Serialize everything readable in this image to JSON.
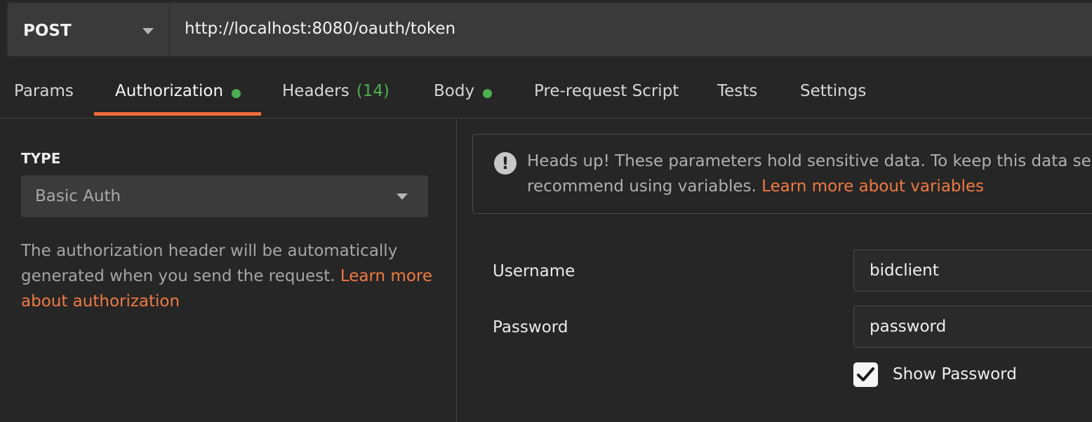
{
  "request": {
    "method": "POST",
    "url": "http://localhost:8080/oauth/token"
  },
  "tabs": [
    {
      "label": "Params"
    },
    {
      "label": "Authorization",
      "active": true,
      "indicator": "green-dot"
    },
    {
      "label": "Headers",
      "count": "(14)"
    },
    {
      "label": "Body",
      "indicator": "green-dot"
    },
    {
      "label": "Pre-request Script"
    },
    {
      "label": "Tests"
    },
    {
      "label": "Settings"
    }
  ],
  "auth": {
    "type_heading": "TYPE",
    "type_value": "Basic Auth",
    "help_text": "The authorization header will be automatically generated when you send the request. ",
    "help_link": "Learn more about authorization"
  },
  "notice": {
    "icon": "info-exclamation-icon",
    "text_line1": "Heads up! These parameters hold sensitive data. To keep this data secur",
    "text_line2": "recommend using variables. ",
    "link": "Learn more about variables"
  },
  "fields": {
    "username_label": "Username",
    "username_value": "bidclient",
    "password_label": "Password",
    "password_value": "password",
    "show_password_label": "Show Password",
    "show_password_checked": true
  },
  "colors": {
    "accent": "#f26b3a",
    "link": "#f07a42",
    "indicator": "#4caf50",
    "background": "#262626"
  }
}
